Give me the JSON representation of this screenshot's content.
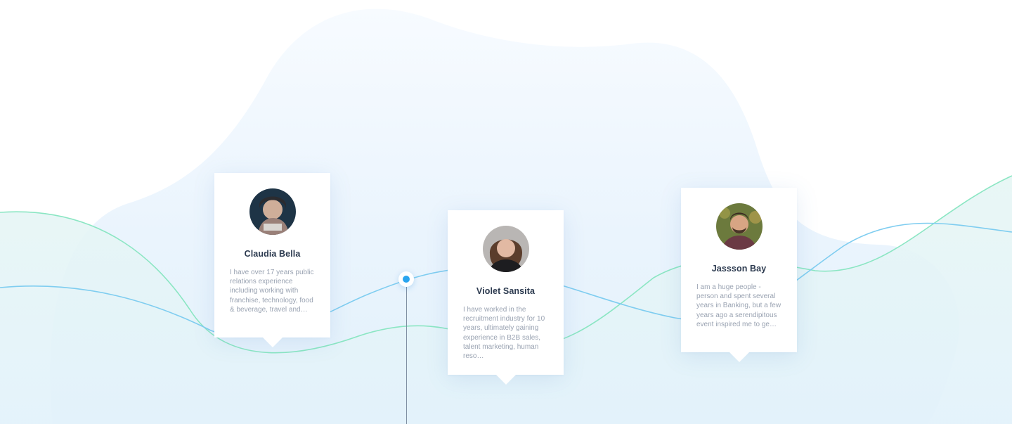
{
  "colors": {
    "blob": "#eef6ff",
    "blue_line": "#7fcdf0",
    "green_line": "#8be6c3",
    "dot": "#2aa5ef"
  },
  "testimonials": [
    {
      "name": "Claudia Bella",
      "bio": "I have over 17 years public relations experience including working with franchise, technology, food & beverage, travel and…",
      "avatar": "claudia-avatar"
    },
    {
      "name": "Violet Sansita",
      "bio": "I have worked in the recruitment industry for 10 years, ultimately gaining experience in B2B sales, talent marketing, human reso…",
      "avatar": "violet-avatar"
    },
    {
      "name": "Jassson Bay",
      "bio": "I am a huge people -person and spent several years in Banking, but a few years ago a serendipitous event inspired me to ge…",
      "avatar": "jassson-avatar"
    }
  ]
}
